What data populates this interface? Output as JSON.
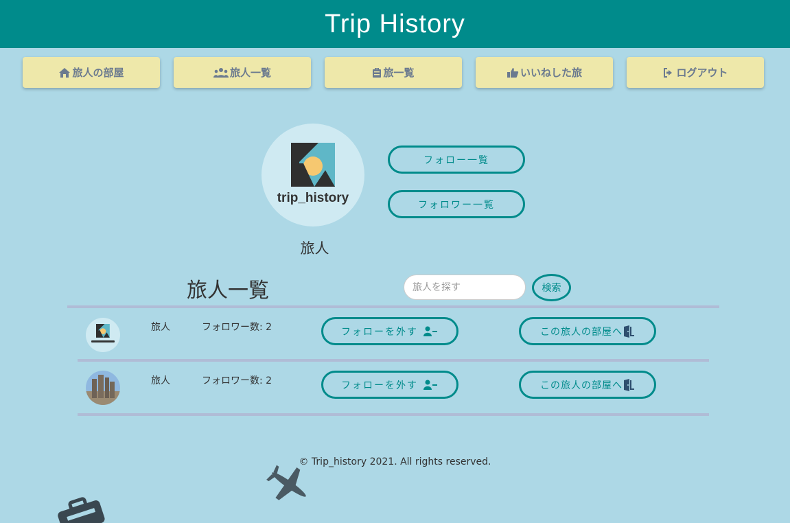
{
  "header": {
    "title": "Trip History"
  },
  "nav": [
    {
      "label": "旅人の部屋",
      "icon": "home-icon"
    },
    {
      "label": "旅人一覧",
      "icon": "users-icon"
    },
    {
      "label": "旅一覧",
      "icon": "suitcase-icon"
    },
    {
      "label": "いいねした旅",
      "icon": "thumbs-up-icon"
    },
    {
      "label": "ログアウト",
      "icon": "sign-out-icon"
    }
  ],
  "profile": {
    "logo_text": "trip_history",
    "username": "旅人",
    "follow_list_label": "フォロー一覧",
    "follower_list_label": "フォロワー一覧"
  },
  "section": {
    "title": "旅人一覧"
  },
  "search": {
    "placeholder": "旅人を探す",
    "button_label": "検索"
  },
  "travelers": [
    {
      "name": "旅人",
      "followers": "フォロワー数: 2",
      "follow_button": "フォローを外す",
      "room_button": "この旅人の部屋へ",
      "avatar": "trip-history-logo"
    },
    {
      "name": "旅人",
      "followers": "フォロワー数: 2",
      "follow_button": "フォローを外す",
      "room_button": "この旅人の部屋へ",
      "avatar": "rock-photo"
    }
  ],
  "footer": {
    "copyright": "© Trip_history 2021. All rights reserved."
  },
  "colors": {
    "header": "#008b8b",
    "background": "#add8e6",
    "nav_button": "#eee8aa",
    "accent": "#008b8b"
  }
}
